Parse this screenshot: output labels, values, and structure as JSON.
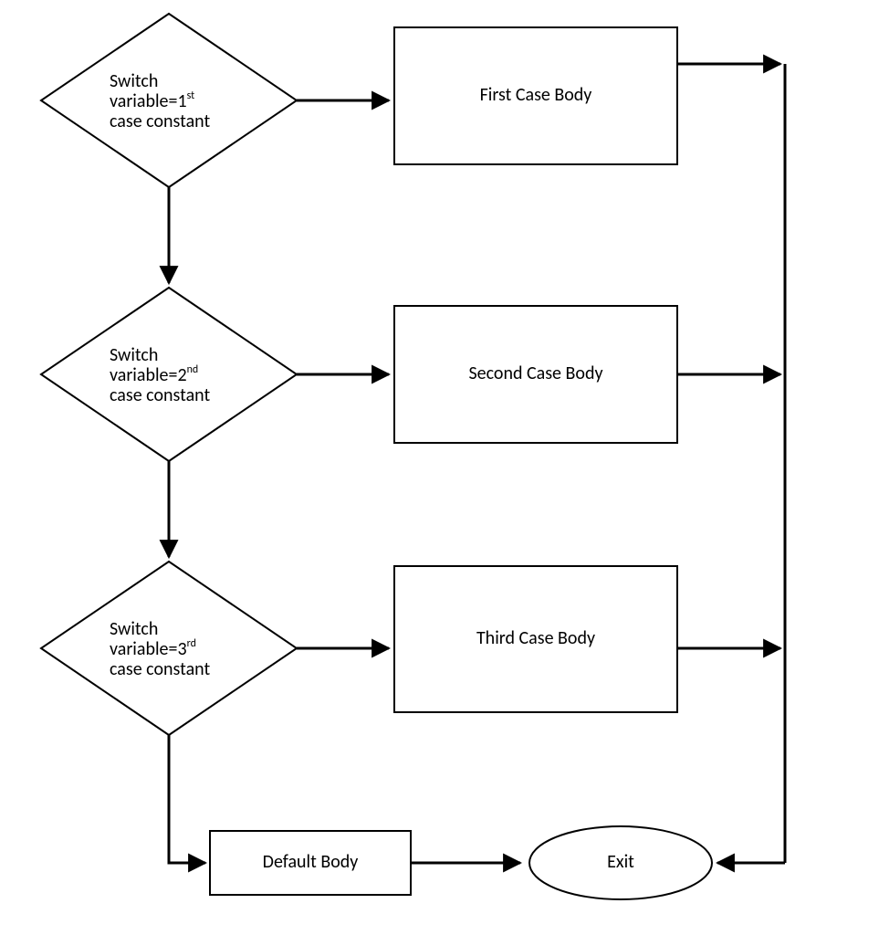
{
  "diagram": {
    "decision1": {
      "line1": "Switch",
      "line2_pre": "variable=1",
      "line2_sup": "st",
      "line3": "case constant"
    },
    "decision2": {
      "line1": "Switch",
      "line2_pre": "variable=2",
      "line2_sup": "nd",
      "line3": "case constant"
    },
    "decision3": {
      "line1": "Switch",
      "line2_pre": "variable=3",
      "line2_sup": "rd",
      "line3": "case constant"
    },
    "process1": "First Case Body",
    "process2": "Second Case Body",
    "process3": "Third Case Body",
    "default": "Default Body",
    "exit": "Exit"
  }
}
